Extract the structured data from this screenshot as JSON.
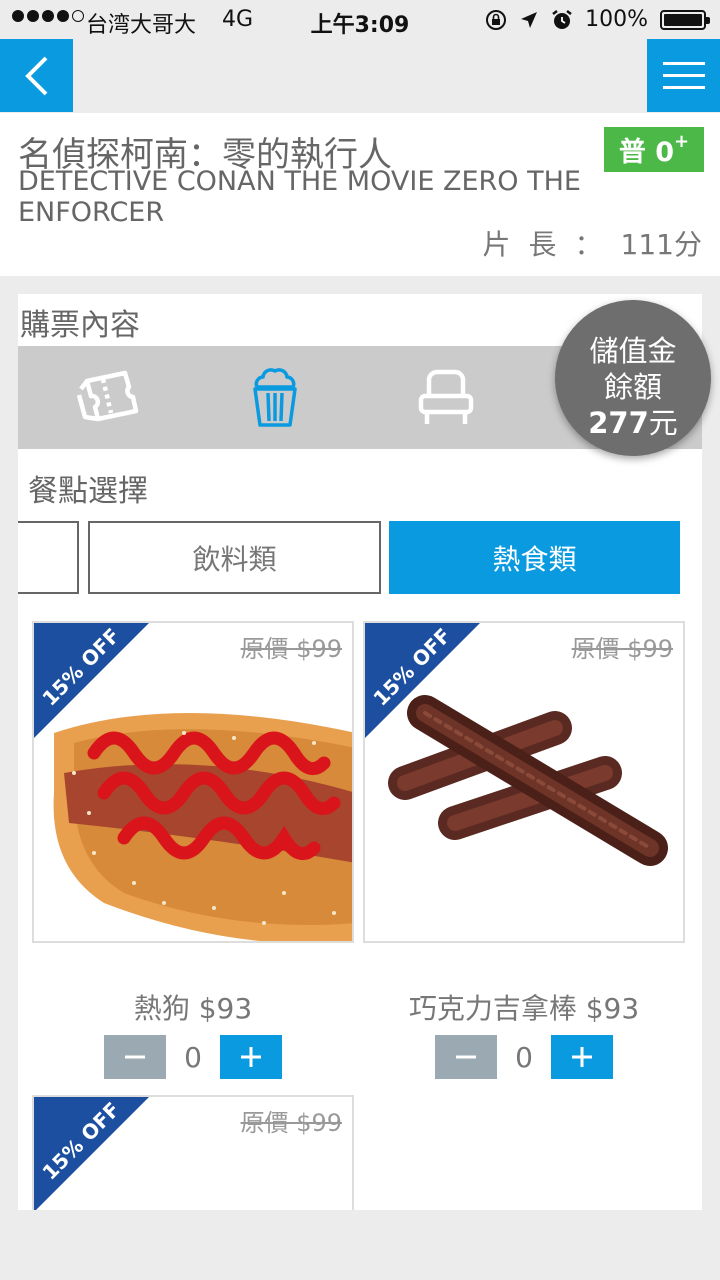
{
  "status_bar": {
    "carrier": "台湾大哥大",
    "network": "4G",
    "time": "上午3:09",
    "battery": "100%",
    "battery_level": 1.0
  },
  "nav": {
    "back_icon": "chevron-left-icon",
    "menu_icon": "hamburger-icon"
  },
  "movie": {
    "title_zh": "名偵探柯南：零的執行人",
    "title_en": "DETECTIVE CONAN THE MOVIE ZERO THE ENFORCER",
    "rating": "普 0",
    "rating_sup": "+",
    "length_label_1": "片",
    "length_label_2": "長",
    "length_sep": "：",
    "length_value": "111分"
  },
  "booking": {
    "section_title": "購票內容",
    "tabs": [
      {
        "icon": "ticket-icon"
      },
      {
        "icon": "popcorn-icon",
        "active": true
      },
      {
        "icon": "seat-icon"
      }
    ],
    "wallet": {
      "line1": "儲值金",
      "line2": "餘額",
      "amount": "277",
      "unit": "元"
    },
    "meal_title": "餐點選擇",
    "categories": [
      "",
      "飲料類",
      "熱食類"
    ],
    "active_category": "熱食類",
    "products": [
      {
        "badge": "15% OFF",
        "original_price": "原價 $99",
        "name": "熱狗 $93",
        "qty": "0"
      },
      {
        "badge": "15% OFF",
        "original_price": "原價 $99",
        "name": "巧克力吉拿棒 $93",
        "qty": "0"
      },
      {
        "badge": "15% OFF",
        "original_price": "原價 $99"
      }
    ]
  },
  "colors": {
    "accent": "#0a9ae0",
    "rating_green": "#4cb848",
    "ribbon_blue": "#1d4fa0",
    "wallet_gray": "#6e6e6e"
  }
}
